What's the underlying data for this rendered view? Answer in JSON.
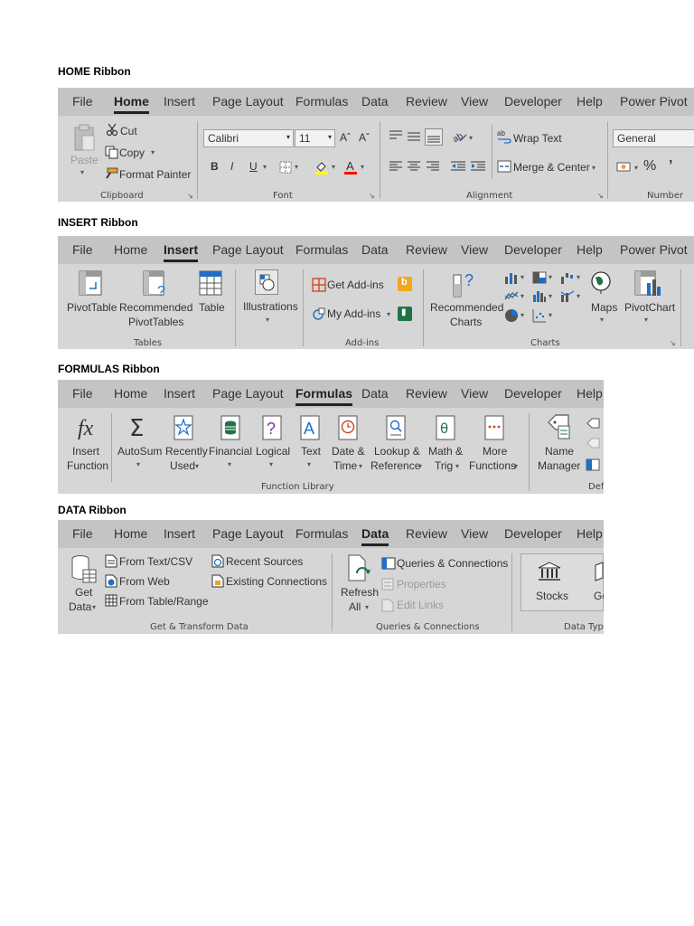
{
  "home": {
    "heading": "HOME Ribbon",
    "tabs": [
      "File",
      "Home",
      "Insert",
      "Page Layout",
      "Formulas",
      "Data",
      "Review",
      "View",
      "Developer",
      "Help",
      "Power Pivot"
    ],
    "clipboard": {
      "paste": "Paste",
      "cut": "Cut",
      "copy": "Copy",
      "format_painter": "Format Painter",
      "group": "Clipboard"
    },
    "font": {
      "name": "Calibri",
      "size": "11",
      "grow": "Aˆ",
      "shrink": "Aˇ",
      "bold": "B",
      "italic": "I",
      "underline": "U",
      "group": "Font"
    },
    "alignment": {
      "wrap_text": "Wrap Text",
      "merge_center": "Merge & Center",
      "group": "Alignment"
    },
    "number": {
      "format": "General",
      "percent": "%",
      "comma": "’",
      "group": "Number"
    }
  },
  "insert": {
    "heading": "INSERT Ribbon",
    "tabs": [
      "File",
      "Home",
      "Insert",
      "Page Layout",
      "Formulas",
      "Data",
      "Review",
      "View",
      "Developer",
      "Help",
      "Power Pivot"
    ],
    "tables": {
      "pivottable": "PivotTable",
      "recommended_1": "Recommended",
      "recommended_2": "PivotTables",
      "table": "Table",
      "group": "Tables"
    },
    "illustrations": {
      "label": "Illustrations"
    },
    "addins": {
      "get": "Get Add-ins",
      "my": "My Add-ins",
      "group": "Add-ins"
    },
    "charts": {
      "recommended_1": "Recommended",
      "recommended_2": "Charts",
      "maps": "Maps",
      "pivotchart": "PivotChart",
      "group": "Charts"
    }
  },
  "formulas": {
    "heading": "FORMULAS Ribbon",
    "tabs": [
      "File",
      "Home",
      "Insert",
      "Page Layout",
      "Formulas",
      "Data",
      "Review",
      "View",
      "Developer",
      "Help"
    ],
    "library": {
      "insert_1": "Insert",
      "insert_2": "Function",
      "autosum": "AutoSum",
      "recently_1": "Recently",
      "recently_2": "Used",
      "financial": "Financial",
      "logical": "Logical",
      "text": "Text",
      "date_1": "Date &",
      "date_2": "Time",
      "lookup_1": "Lookup &",
      "lookup_2": "Reference",
      "math_1": "Math &",
      "math_2": "Trig",
      "more_1": "More",
      "more_2": "Functions",
      "group": "Function Library"
    },
    "names": {
      "name_1": "Name",
      "name_2": "Manager",
      "group_partial": "Defi"
    }
  },
  "data": {
    "heading": "DATA Ribbon",
    "tabs": [
      "File",
      "Home",
      "Insert",
      "Page Layout",
      "Formulas",
      "Data",
      "Review",
      "View",
      "Developer",
      "Help"
    ],
    "get": {
      "get_1": "Get",
      "get_2": "Data",
      "from_text": "From Text/CSV",
      "from_web": "From Web",
      "from_table": "From Table/Range",
      "recent": "Recent Sources",
      "existing": "Existing Connections",
      "group": "Get & Transform Data"
    },
    "queries": {
      "refresh_1": "Refresh",
      "refresh_2": "All",
      "qc": "Queries & Connections",
      "properties": "Properties",
      "edit_links": "Edit Links",
      "group": "Queries & Connections"
    },
    "types": {
      "stocks": "Stocks",
      "geo_partial": "Geo",
      "group_partial": "Data Type"
    }
  }
}
